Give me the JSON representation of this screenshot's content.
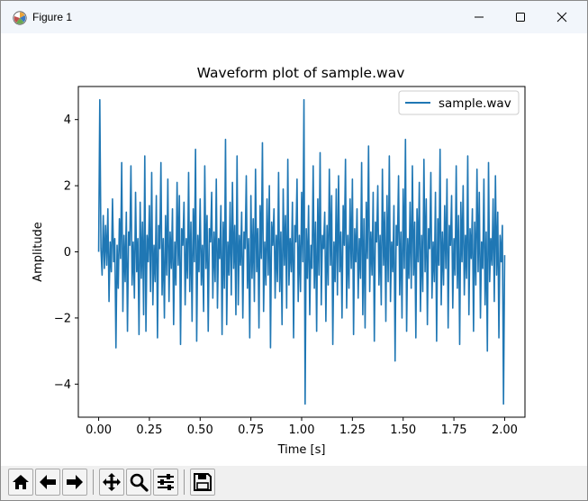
{
  "window": {
    "title": "Figure 1",
    "controls": [
      "minimize",
      "maximize",
      "close"
    ]
  },
  "toolbar": {
    "buttons": [
      {
        "name": "home-button",
        "icon": "home-icon"
      },
      {
        "name": "back-button",
        "icon": "arrow-left-icon"
      },
      {
        "name": "forward-button",
        "icon": "arrow-right-icon"
      },
      {
        "name": "pan-button",
        "icon": "move-icon"
      },
      {
        "name": "zoom-button",
        "icon": "magnifier-icon"
      },
      {
        "name": "configure-subplots-button",
        "icon": "sliders-icon"
      },
      {
        "name": "save-button",
        "icon": "floppy-disk-icon"
      }
    ]
  },
  "colors": {
    "line": "#1f77b4",
    "titlebar": "#f2f6fb",
    "toolbar": "#f0f0f0"
  },
  "chart_data": {
    "type": "line",
    "title": "Waveform plot of sample.wav",
    "xlabel": "Time [s]",
    "ylabel": "Amplitude",
    "xlim": [
      -0.1,
      2.1
    ],
    "ylim": [
      -5.0,
      5.0
    ],
    "xticks": [
      0.0,
      0.25,
      0.5,
      0.75,
      1.0,
      1.25,
      1.5,
      1.75,
      2.0
    ],
    "xtick_labels": [
      "0.00",
      "0.25",
      "0.50",
      "0.75",
      "1.00",
      "1.25",
      "1.50",
      "1.75",
      "2.00"
    ],
    "yticks": [
      -4,
      -2,
      0,
      2,
      4
    ],
    "ytick_labels": [
      "−4",
      "−2",
      "0",
      "2",
      "4"
    ],
    "grid": false,
    "legend_position": "top-right",
    "series": [
      {
        "name": "sample.wav",
        "x_start": 0.0,
        "x_end": 2.0,
        "values": [
          0.0,
          4.6,
          0.1,
          -0.7,
          1.1,
          -0.5,
          0.8,
          -0.4,
          1.3,
          -1.5,
          0.3,
          -0.6,
          1.6,
          -0.3,
          0.4,
          -2.9,
          0.2,
          -1.1,
          1.0,
          -0.2,
          2.7,
          -1.8,
          0.5,
          -0.9,
          1.2,
          -2.4,
          0.6,
          0.2,
          2.6,
          -1.0,
          0.3,
          -1.4,
          1.8,
          -0.6,
          0.4,
          -2.5,
          1.5,
          -0.8,
          0.9,
          -1.9,
          2.9,
          -2.4,
          0.5,
          -0.3,
          1.4,
          -1.2,
          2.4,
          -1.6,
          0.2,
          -0.9,
          1.7,
          -2.6,
          0.8,
          0.1,
          2.7,
          -1.3,
          0.4,
          -2.0,
          1.1,
          -0.7,
          2.2,
          -1.5,
          0.6,
          -0.5,
          1.3,
          -2.2,
          0.3,
          -1.0,
          2.1,
          -0.4,
          1.7,
          -2.8,
          0.7,
          0.2,
          1.5,
          -1.6,
          0.4,
          -0.8,
          2.4,
          -1.2,
          0.9,
          -2.1,
          1.3,
          -0.3,
          3.1,
          -2.7,
          0.5,
          -0.6,
          1.6,
          -1.0,
          0.2,
          -1.8,
          2.6,
          -0.5,
          1.1,
          -2.4,
          0.7,
          0.3,
          1.8,
          -1.4,
          0.6,
          -0.9,
          2.2,
          -1.7,
          0.4,
          -0.2,
          1.4,
          -2.5,
          0.9,
          -1.1,
          3.4,
          -2.2,
          0.3,
          -0.7,
          1.5,
          -1.3,
          2.1,
          -0.5,
          0.8,
          -1.9,
          2.9,
          -1.6,
          0.5,
          -0.4,
          1.2,
          -2.0,
          0.6,
          0.1,
          2.3,
          -1.1,
          0.4,
          -2.6,
          1.7,
          -0.8,
          1.0,
          -1.5,
          2.5,
          -0.6,
          0.7,
          -2.3,
          1.4,
          -0.2,
          3.3,
          -1.8,
          0.3,
          -1.0,
          1.6,
          -0.7,
          2.0,
          -2.9,
          0.9,
          0.2,
          1.3,
          -1.4,
          0.5,
          -0.9,
          2.4,
          -1.2,
          0.6,
          -2.2,
          1.9,
          -0.4,
          1.1,
          -1.7,
          2.8,
          -1.0,
          0.4,
          -0.6,
          1.5,
          -2.6,
          0.8,
          0.3,
          2.2,
          -1.5,
          0.5,
          -1.2,
          1.8,
          -0.3,
          4.6,
          -4.6,
          0.7,
          -0.8,
          1.4,
          -1.9,
          0.2,
          -0.5,
          2.6,
          -1.1,
          0.9,
          -2.4,
          1.6,
          -0.7,
          3.0,
          -1.6,
          0.5,
          0.1,
          1.2,
          -2.1,
          0.8,
          -1.0,
          2.5,
          -0.4,
          1.7,
          -2.8,
          0.3,
          -0.9,
          1.9,
          -1.3,
          2.3,
          -0.6,
          0.6,
          -2.0,
          1.4,
          0.2,
          2.8,
          -1.7,
          0.5,
          -1.1,
          1.6,
          -0.5,
          2.2,
          -2.5,
          0.7,
          -0.3,
          1.3,
          -1.4,
          0.4,
          -0.8,
          2.7,
          -1.9,
          1.0,
          -2.3,
          1.5,
          -0.2,
          3.2,
          -1.2,
          0.6,
          -0.7,
          1.8,
          -2.7,
          0.9,
          0.3,
          2.0,
          -1.0,
          0.5,
          -1.6,
          2.5,
          -0.4,
          1.2,
          -2.1,
          1.7,
          -0.9,
          2.9,
          -1.5,
          0.3,
          -0.6,
          1.4,
          -3.3,
          0.8,
          0.2,
          2.3,
          -1.3,
          0.6,
          -2.0,
          1.9,
          -0.5,
          3.4,
          -2.4,
          0.4,
          -0.8,
          1.5,
          -1.1,
          2.6,
          -0.7,
          0.9,
          -2.6,
          1.3,
          -0.3,
          2.1,
          -1.8,
          0.5,
          -1.2,
          2.8,
          -0.6,
          1.6,
          -2.2,
          0.7,
          0.1,
          2.4,
          -1.4,
          0.3,
          -0.9,
          1.8,
          -2.7,
          1.0,
          -0.4,
          3.1,
          -1.6,
          0.6,
          -1.0,
          1.4,
          -0.5,
          2.2,
          -2.3,
          0.8,
          0.2,
          1.7,
          -1.7,
          0.4,
          -0.7,
          2.6,
          -1.1,
          1.1,
          -2.8,
          1.5,
          -0.3,
          2.0,
          -1.3,
          0.5,
          -0.8,
          2.9,
          -1.9,
          0.7,
          -0.2,
          1.3,
          -2.4,
          0.9,
          -1.0,
          2.5,
          -0.6,
          1.8,
          -2.0,
          0.3,
          -0.5,
          2.2,
          -1.6,
          0.6,
          -3.0,
          2.7,
          -0.9,
          0.4,
          -0.4,
          1.6,
          -1.5,
          2.3,
          -0.7,
          1.2,
          -2.6,
          0.5,
          -0.3,
          0.8,
          -4.6,
          -0.1
        ]
      }
    ]
  }
}
